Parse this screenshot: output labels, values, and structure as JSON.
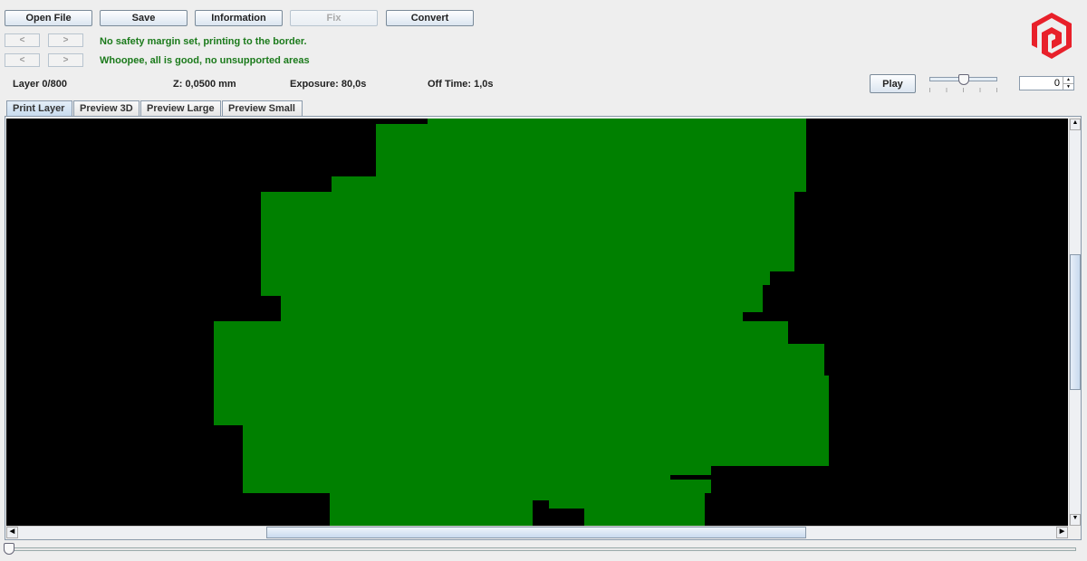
{
  "toolbar": {
    "open_file": "Open File",
    "save": "Save",
    "information": "Information",
    "fix": "Fix",
    "convert": "Convert"
  },
  "nav": {
    "prev": "<",
    "next": ">"
  },
  "messages": {
    "margin": "No safety margin set, printing to the border.",
    "support": "Whoopee, all is good, no unsupported areas"
  },
  "status": {
    "layer": "Layer 0/800",
    "z": "Z: 0,0500 mm",
    "exposure": "Exposure: 80,0s",
    "off_time": "Off Time: 1,0s"
  },
  "playback": {
    "play": "Play",
    "speed_fraction": 0.5,
    "spinner_value": "0"
  },
  "tabs": [
    {
      "label": "Print Layer",
      "active": true
    },
    {
      "label": "Preview 3D"
    },
    {
      "label": "Preview Large"
    },
    {
      "label": "Preview Small"
    }
  ],
  "layer_slider": {
    "value": 0,
    "max": 800
  },
  "colors": {
    "layer_fill": "#008000",
    "background": "#000000",
    "logo": "#e8202a",
    "message": "#1b7a1b"
  },
  "icons": {
    "logo": "photon-logo",
    "scroll_up": "arrow-up-icon",
    "scroll_down": "arrow-down-icon",
    "scroll_left": "arrow-left-icon",
    "scroll_right": "arrow-right-icon"
  }
}
